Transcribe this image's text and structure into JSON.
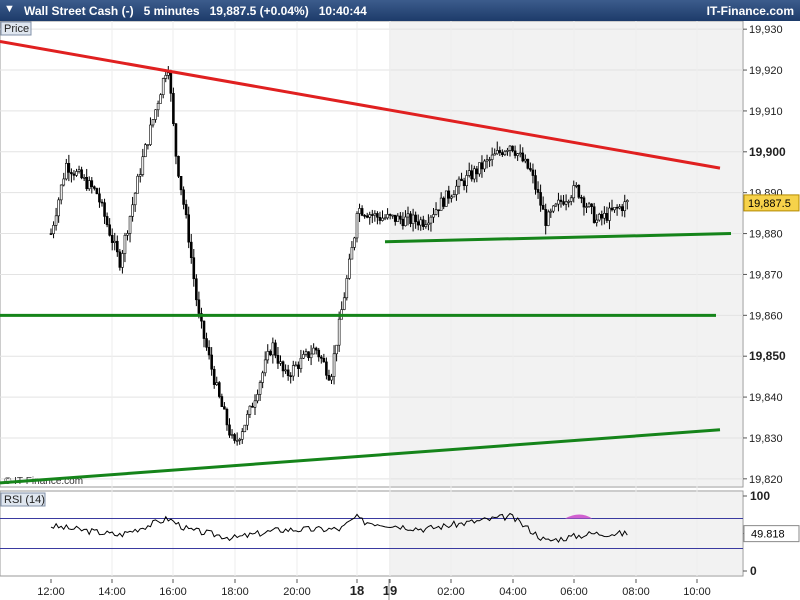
{
  "header": {
    "instrument": "Wall Street Cash (-)",
    "timeframe": "5 minutes",
    "price_change": "19,887.5 (+0.04%)",
    "time": "10:40:44",
    "brand": "IT-Finance.com",
    "arrow_icon": "triangle-down-icon"
  },
  "price_panel": {
    "label": "Price",
    "watermark": "© IT-Finance.com",
    "last_price_label": "19,887.5",
    "last_price_value": 19887.5,
    "ylim": [
      19818,
      19932
    ],
    "y_ticks": [
      19820,
      19830,
      19840,
      19850,
      19860,
      19870,
      19880,
      19890,
      19900,
      19910,
      19920,
      19930
    ],
    "y_tick_labels": [
      "19,820",
      "19,830",
      "19,840",
      "19,850",
      "19,860",
      "19,870",
      "19,880",
      "19,890",
      "19,900",
      "19,910",
      "19,920",
      "19,930"
    ],
    "bold_ticks": [
      "19,850",
      "19,900"
    ]
  },
  "rsi_panel": {
    "label": "RSI (14)",
    "value": 49.818,
    "value_label": "49.818",
    "ylim": [
      0,
      100
    ],
    "levels": [
      70,
      30
    ],
    "y_tick_labels": [
      "100",
      "50",
      "0"
    ]
  },
  "x_axis": {
    "labels": [
      "12:00",
      "14:00",
      "16:00",
      "18:00",
      "20:00",
      "18",
      "19",
      "02:00",
      "04:00",
      "06:00",
      "08:00",
      "10:00"
    ],
    "bold_labels": [
      "18",
      "19"
    ]
  },
  "colors": {
    "resistance": "#e02020",
    "support": "#15841a",
    "candle_up": "#ffffff",
    "candle_down": "#000000",
    "rsi_line": "#000000",
    "rsi_band": "#3a3aa0",
    "rsi_overbought_fill": "#d060d0",
    "last_price_bg": "#f6d24a",
    "session_shade": "#f2f2f2",
    "header_bg": "#1d3b6a"
  },
  "chart_data": {
    "type": "candlestick",
    "interval": "5 minutes",
    "instrument": "Wall Street Cash (-)",
    "last": 19887.5,
    "change_pct": 0.04,
    "path_points": [
      [
        "12:00 (day 18)",
        19880
      ],
      [
        "12:30",
        19897
      ],
      [
        "13:30",
        19890
      ],
      [
        "14:15",
        19873
      ],
      [
        "15:00",
        19898
      ],
      [
        "15:50",
        19922
      ],
      [
        "16:05",
        19900
      ],
      [
        "16:30",
        19880
      ],
      [
        "16:50",
        19860
      ],
      [
        "17:30",
        19840
      ],
      [
        "18:00",
        19828
      ],
      [
        "18:30",
        19836
      ],
      [
        "19:15",
        19853
      ],
      [
        "19:40",
        19845
      ],
      [
        "20:40",
        19852
      ],
      [
        "21:10",
        19845
      ],
      [
        "22:00 (day 18)",
        19882
      ],
      [
        "00:00 (day 19)",
        19882
      ],
      [
        "01:00",
        19889
      ],
      [
        "02:30",
        19884
      ],
      [
        "04:00",
        19883
      ],
      [
        "05:00",
        19891
      ],
      [
        "06:00",
        19897
      ],
      [
        "06:50",
        19902
      ],
      [
        "07:30",
        19895
      ],
      [
        "08:00",
        19883
      ],
      [
        "08:30",
        19888
      ],
      [
        "09:00",
        19891
      ],
      [
        "09:40",
        19883
      ],
      [
        "10:40 (day 19)",
        19887.5
      ]
    ],
    "trendlines": [
      {
        "name": "Resistance",
        "color": "red",
        "from": [
          "11:00 (day 18)",
          19927
        ],
        "to": [
          "10:40 (day 19)",
          19896
        ]
      },
      {
        "name": "Support",
        "color": "green",
        "from": [
          "11:00 (day 18)",
          19819
        ],
        "to": [
          "10:40 (day 19)",
          19832
        ]
      },
      {
        "name": "Horizontal support",
        "color": "green",
        "from": [
          "11:00 (day 18)",
          19860
        ],
        "to": [
          "10:40 (day 19)",
          19860
        ]
      },
      {
        "name": "Range floor",
        "color": "green",
        "from": [
          "00:00 (day 19)",
          19878
        ],
        "to": [
          "10:40 (day 19)",
          19880
        ]
      }
    ],
    "rsi": {
      "period": 14,
      "last": 49.818,
      "path_points": [
        [
          "12:00 (day 18)",
          60
        ],
        [
          "14:15",
          48
        ],
        [
          "15:50",
          70
        ],
        [
          "16:30",
          55
        ],
        [
          "18:00",
          44
        ],
        [
          "19:30",
          55
        ],
        [
          "21:30",
          56
        ],
        [
          "22:00 (day 18)",
          72
        ],
        [
          "02:00",
          66
        ],
        [
          "04:00",
          56
        ],
        [
          "06:00",
          68
        ],
        [
          "06:50",
          73
        ],
        [
          "08:00",
          40
        ],
        [
          "09:30",
          50
        ],
        [
          "10:40 (day 19)",
          49.8
        ]
      ]
    },
    "ylabel": "Price",
    "ylim": [
      19818,
      19932
    ]
  }
}
